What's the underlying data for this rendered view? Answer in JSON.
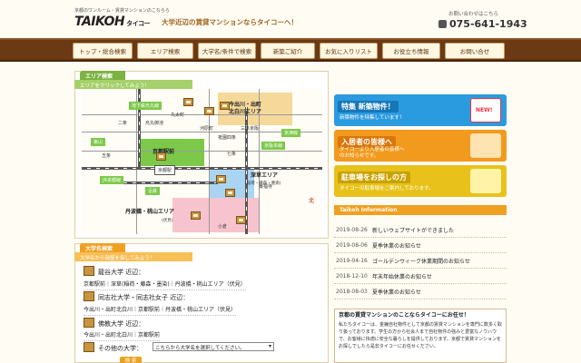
{
  "header": {
    "tagline": "京都のワンルーム・賃貸マンションのこならら",
    "logo": "TAIKOH",
    "logo_kana": "タイコー",
    "catch_copy": "大学近辺の賃貸マンションならタイコーへ！",
    "contact_label": "お問い合わせはこちら",
    "phone": "075-641-1943"
  },
  "nav": {
    "items": [
      {
        "label": "トップ・総合検索"
      },
      {
        "label": "エリア検索"
      },
      {
        "label": "大学名/条件で検索"
      },
      {
        "label": "新築ご紹介"
      },
      {
        "label": "お気に入りリスト"
      },
      {
        "label": "お役立ち情報"
      },
      {
        "label": "お問い合せ"
      }
    ]
  },
  "area_search": {
    "title": "エリア検索",
    "subtitle": "エリアをクリックしてみよう！",
    "map": {
      "labels": [
        "地下鉄烏丸線",
        "二条",
        "烏丸御池",
        "丸太町",
        "河原町",
        "祇園四条",
        "三条京阪",
        "東山",
        "京阪本線",
        "五条",
        "京津線",
        "七条",
        "京都駅",
        "JR京都線",
        "近鉄",
        "東福寺",
        "小倉"
      ],
      "station_box": "京都駅",
      "areas": [
        {
          "name": "今出川・出町\n北白川エリア"
        },
        {
          "name": "京都駅前"
        },
        {
          "name": "深草エリア",
          "sub": "(稲荷・藤森・墨染)"
        },
        {
          "name": "丹波橋・桃山エリア",
          "sub": "(伏見)"
        }
      ],
      "kita": "北"
    }
  },
  "university_search": {
    "title": "大学名検索",
    "subtitle": "大学名から部屋を探してみよう！",
    "universities": [
      {
        "name": "龍谷大学 近辺：",
        "links": "京都駅前｜深草(稲荷・藤森・墨染)｜丹波橋・桃山エリア（伏見）"
      },
      {
        "name": "同志社大学・同志社女子 近辺：",
        "links": "今出川・出町北白川｜京都駅前｜丹波橋・桃山エリア（伏見）"
      },
      {
        "name": "佛教大学 近辺：",
        "links": "今出川・出町北白川｜京都駅前"
      }
    ],
    "other_label": "その他の大学：",
    "select_value": "こちらから大学名を選択してください。",
    "search_label": "検 索"
  },
  "banners": [
    {
      "title": "特集 新築物件！",
      "sub": "新築物件を特集しています！",
      "badge": "NEW!"
    },
    {
      "title": "入居者の皆様へ",
      "sub": "タイコーより入居者の皆様へ\nのお知らせです。"
    },
    {
      "title": "駐車場をお探しの方",
      "sub": "タイコーの駐車場をご案内しております。"
    }
  ],
  "information": {
    "title": "Taikoh Information",
    "news": [
      {
        "date": "2019-08-26",
        "title": "新しいウェブサイトができました"
      },
      {
        "date": "2019-08-06",
        "title": "夏季休業のお知らせ"
      },
      {
        "date": "2019-04-16",
        "title": "ゴールデンウィーク休業期間のお知らせ"
      },
      {
        "date": "2018-12-10",
        "title": "年末年始休業のお知らせ"
      },
      {
        "date": "2018-08-03",
        "title": "夏季休業のお知らせ"
      }
    ]
  },
  "about": {
    "title": "京都の賃貸マンションのことならタイコーにお任せ！",
    "body": "私たちタイコーは、金鐘自社物件として京都の賃貸マンションを専門に数多く取り扱っております。学生の方から社会人まで自社物件の強みと豊富なノウハウで、お客様に快適に安全な暮らしを提供しております。京都で賃貸マンションをお探しでしたら是非タイコーにお任せください。"
  },
  "colors": {
    "nav_bg": "#6b3a14",
    "accent_green": "#7cb342",
    "accent_orange": "#f0a020",
    "banner_blue": "#2b9be0",
    "banner_orange": "#f29a1e",
    "banner_yellow": "#e8c21a"
  }
}
